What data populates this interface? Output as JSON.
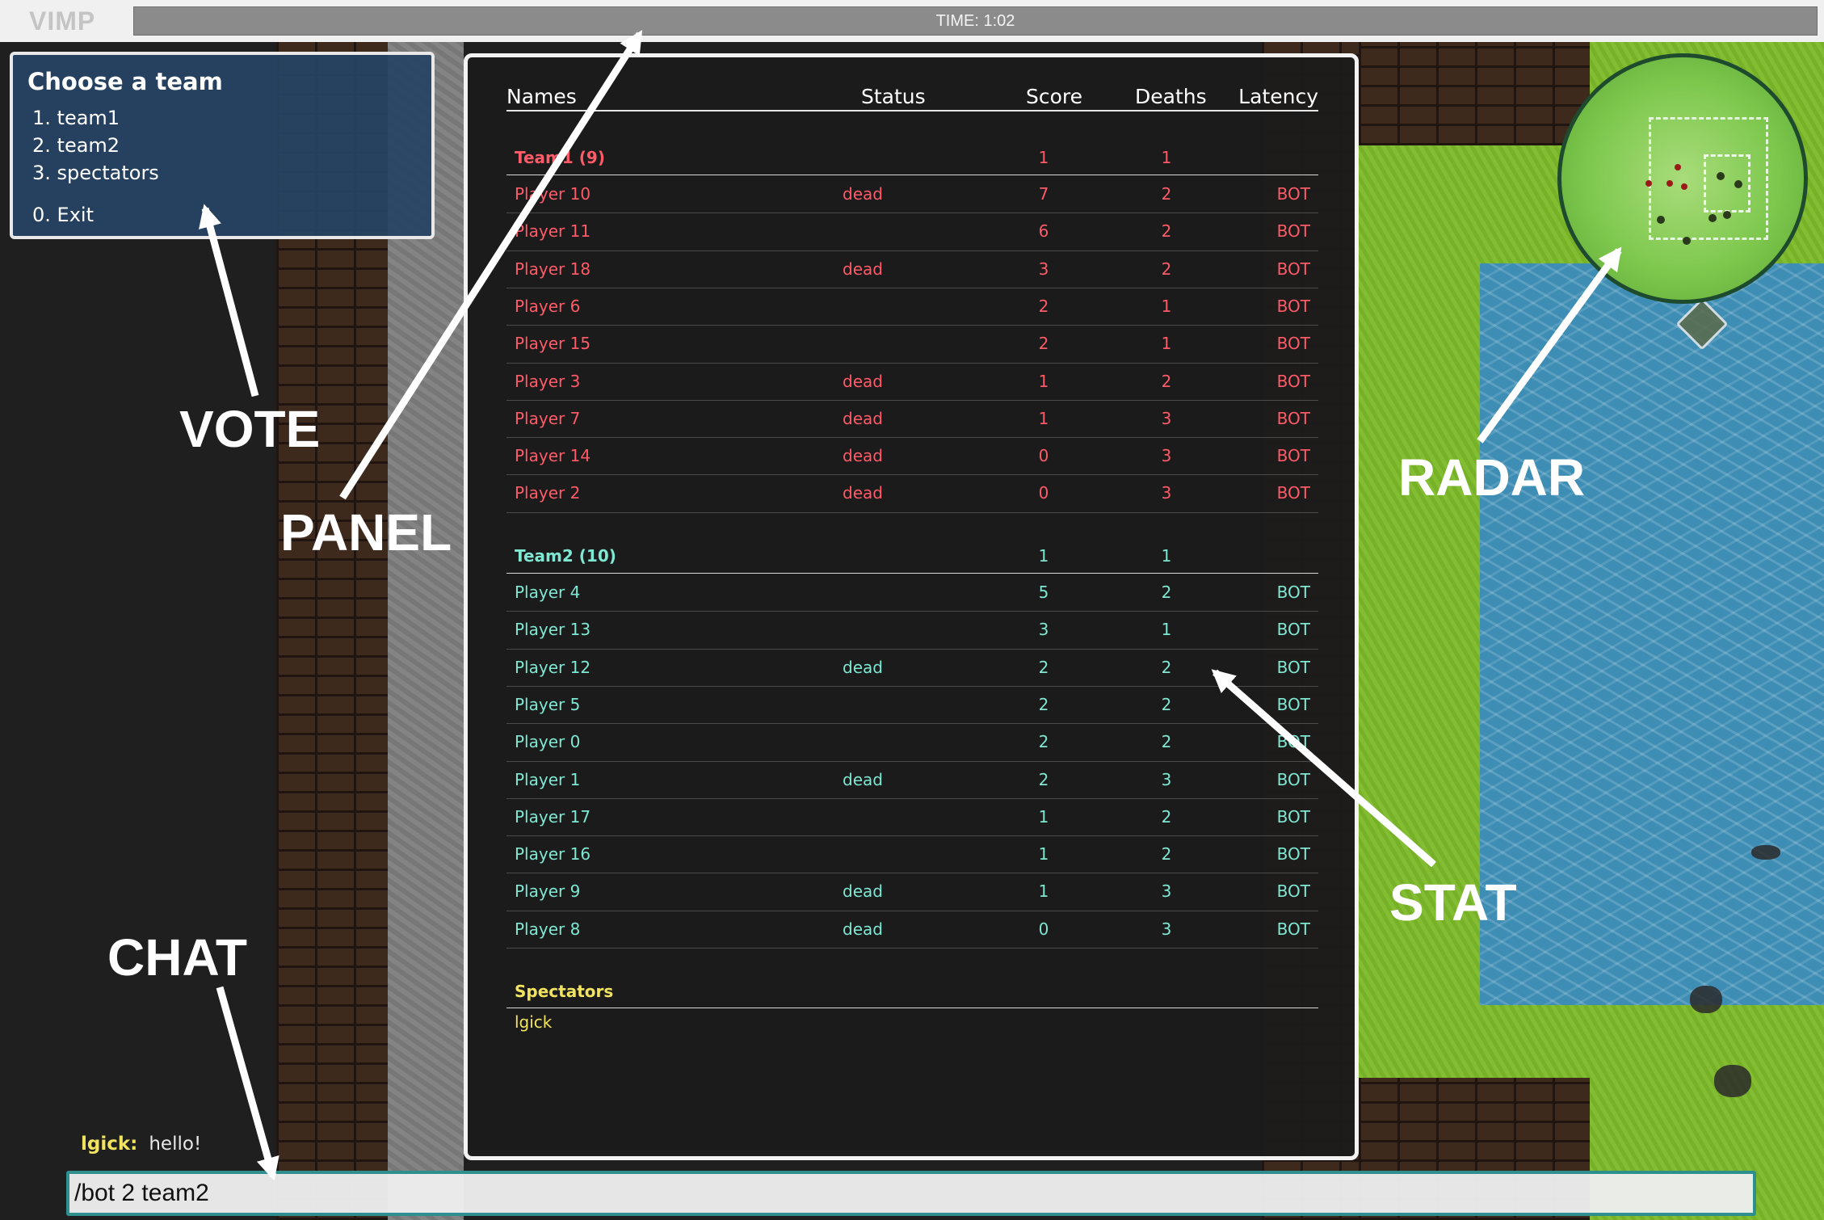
{
  "app": {
    "logo": "VIMP",
    "timer": "TIME: 1:02"
  },
  "vote": {
    "title": "Choose a team",
    "options": [
      "1. team1",
      "2. team2",
      "3. spectators"
    ],
    "exit": "0. Exit"
  },
  "stats": {
    "headers": {
      "names": "Names",
      "status": "Status",
      "score": "Score",
      "deaths": "Deaths",
      "latency": "Latency"
    },
    "team1": {
      "title": "Team1 (9)",
      "score": "1",
      "deaths": "1",
      "color": "#ff5a68",
      "players": [
        {
          "name": "Player 10",
          "status": "dead",
          "score": "7",
          "deaths": "2",
          "latency": "BOT"
        },
        {
          "name": "Player 11",
          "status": "",
          "score": "6",
          "deaths": "2",
          "latency": "BOT"
        },
        {
          "name": "Player 18",
          "status": "dead",
          "score": "3",
          "deaths": "2",
          "latency": "BOT"
        },
        {
          "name": "Player 6",
          "status": "",
          "score": "2",
          "deaths": "1",
          "latency": "BOT"
        },
        {
          "name": "Player 15",
          "status": "",
          "score": "2",
          "deaths": "1",
          "latency": "BOT"
        },
        {
          "name": "Player 3",
          "status": "dead",
          "score": "1",
          "deaths": "2",
          "latency": "BOT"
        },
        {
          "name": "Player 7",
          "status": "dead",
          "score": "1",
          "deaths": "3",
          "latency": "BOT"
        },
        {
          "name": "Player 14",
          "status": "dead",
          "score": "0",
          "deaths": "3",
          "latency": "BOT"
        },
        {
          "name": "Player 2",
          "status": "dead",
          "score": "0",
          "deaths": "3",
          "latency": "BOT"
        }
      ]
    },
    "team2": {
      "title": "Team2 (10)",
      "score": "1",
      "deaths": "1",
      "color": "#7ee8d2",
      "players": [
        {
          "name": "Player 4",
          "status": "",
          "score": "5",
          "deaths": "2",
          "latency": "BOT"
        },
        {
          "name": "Player 13",
          "status": "",
          "score": "3",
          "deaths": "1",
          "latency": "BOT"
        },
        {
          "name": "Player 12",
          "status": "dead",
          "score": "2",
          "deaths": "2",
          "latency": "BOT"
        },
        {
          "name": "Player 5",
          "status": "",
          "score": "2",
          "deaths": "2",
          "latency": "BOT"
        },
        {
          "name": "Player 0",
          "status": "",
          "score": "2",
          "deaths": "2",
          "latency": "BOT"
        },
        {
          "name": "Player 1",
          "status": "dead",
          "score": "2",
          "deaths": "3",
          "latency": "BOT"
        },
        {
          "name": "Player 17",
          "status": "",
          "score": "1",
          "deaths": "2",
          "latency": "BOT"
        },
        {
          "name": "Player 16",
          "status": "",
          "score": "1",
          "deaths": "2",
          "latency": "BOT"
        },
        {
          "name": "Player 9",
          "status": "dead",
          "score": "1",
          "deaths": "3",
          "latency": "BOT"
        },
        {
          "name": "Player 8",
          "status": "dead",
          "score": "0",
          "deaths": "3",
          "latency": "BOT"
        }
      ]
    },
    "spectators": {
      "title": "Spectators",
      "players": [
        "lgick"
      ],
      "color": "#f2e35e"
    }
  },
  "chat": {
    "username": "lgick:",
    "message": "hello!",
    "input_value": "/bot 2 team2"
  },
  "annotations": {
    "vote": "VOTE",
    "panel": "PANEL",
    "radar": "RADAR",
    "stat": "STAT",
    "chat": "CHAT"
  },
  "colors": {
    "team1": "#ff5a68",
    "team2": "#7ee8d2",
    "spectators": "#f2e35e",
    "vote_bg": "#264464",
    "grass": "#7dba2a",
    "water": "#3d8db4"
  },
  "icons": {
    "radar": "radar-minimap-icon",
    "arrows": "annotation-arrow-icon"
  }
}
